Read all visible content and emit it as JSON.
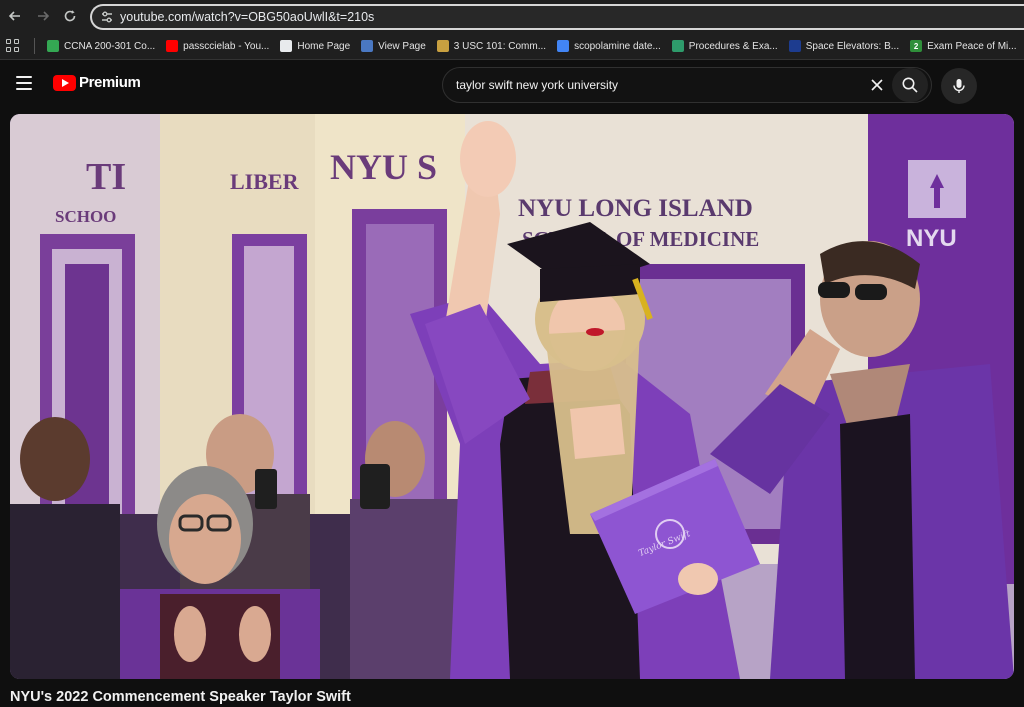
{
  "browser": {
    "url": "youtube.com/watch?v=OBG50aoUwlI&t=210s",
    "icons": {
      "back": "arrow-left-icon",
      "forward": "arrow-right-icon",
      "reload": "reload-icon",
      "site_settings": "tune-icon"
    }
  },
  "bookmarks": [
    {
      "label": "CCNA 200-301 Co...",
      "icon": "google-drive-icon",
      "color": "#34a853"
    },
    {
      "label": "passccielab - You...",
      "icon": "youtube-icon",
      "color": "#ff0000"
    },
    {
      "label": "Home Page",
      "icon": "page-icon",
      "color": "#e8eaed"
    },
    {
      "label": "View Page",
      "icon": "globe-icon",
      "color": "#4a78c2"
    },
    {
      "label": "3 USC 101: Comm...",
      "icon": "seal-icon",
      "color": "#c8a040"
    },
    {
      "label": "scopolamine date...",
      "icon": "google-icon",
      "color": "#4285f4"
    },
    {
      "label": "Procedures & Exa...",
      "icon": "flower-icon",
      "color": "#2e9b6b"
    },
    {
      "label": "Space Elevators: B...",
      "icon": "nasa-icon",
      "color": "#1d3c8f"
    },
    {
      "label": "Exam Peace of Mi...",
      "icon": "number-2-icon",
      "color": "#2f8f3a",
      "glyph": "2"
    }
  ],
  "youtube": {
    "logo_text": "Premium",
    "brand_color": "#ff0000",
    "search_query": "taylor swift new york university",
    "icons": {
      "menu": "hamburger-menu-icon",
      "clear": "close-icon",
      "search": "search-icon",
      "voice": "microphone-icon"
    }
  },
  "video": {
    "title": "NYU's 2022 Commencement Speaker Taylor Swift",
    "scene": {
      "banner_left_1": "TI",
      "banner_left_2": "SCHOO",
      "banner_liber": "LIBER",
      "banner_nyu": "NYU S",
      "banner_main_1": "NYU LONG ISLAND",
      "banner_main_2": "SCHOOL OF MEDICINE",
      "logo_text": "NYU",
      "folder_text": "Taylor Swift"
    }
  }
}
